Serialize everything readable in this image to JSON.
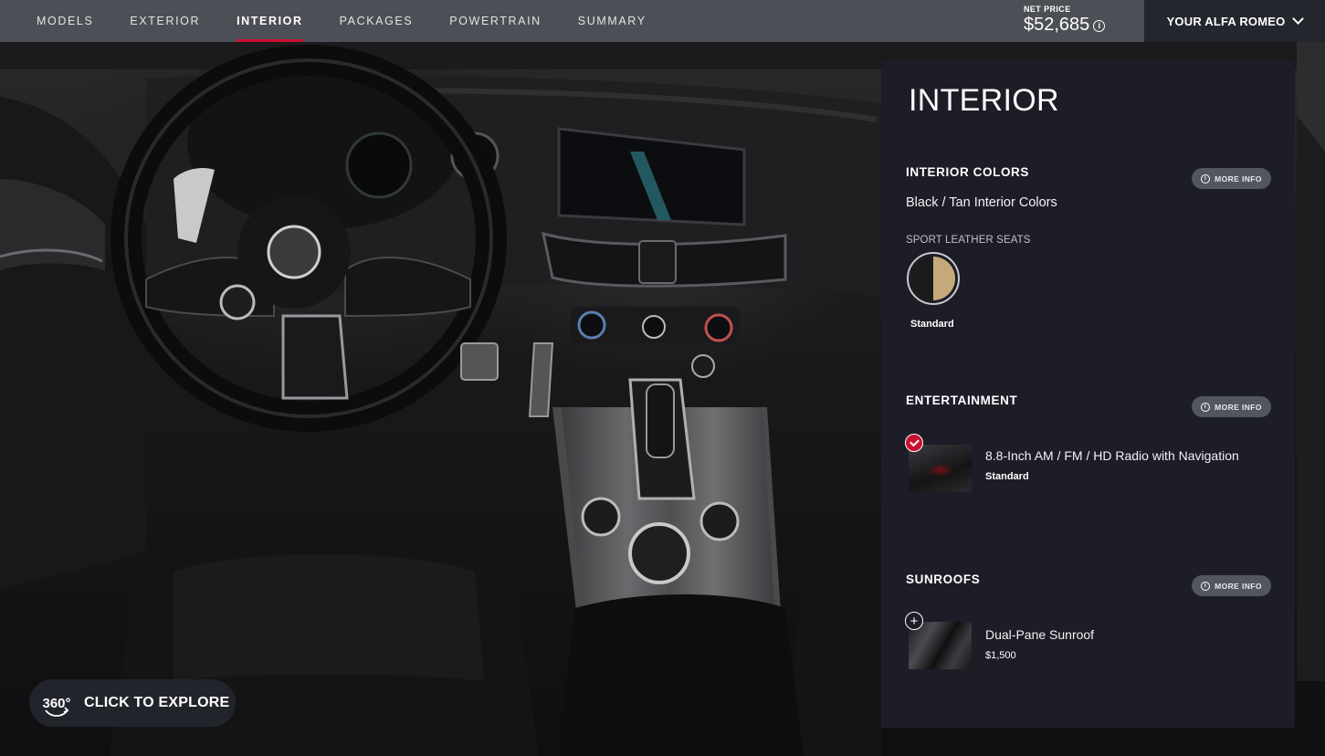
{
  "nav": {
    "items": [
      {
        "label": "MODELS",
        "active": false
      },
      {
        "label": "EXTERIOR",
        "active": false
      },
      {
        "label": "INTERIOR",
        "active": true
      },
      {
        "label": "PACKAGES",
        "active": false
      },
      {
        "label": "POWERTRAIN",
        "active": false
      },
      {
        "label": "SUMMARY",
        "active": false
      }
    ],
    "accent_color": "#c8102e"
  },
  "price": {
    "label": "NET PRICE",
    "value": "$52,685",
    "info_icon": "info-circle-icon"
  },
  "account": {
    "label": "YOUR ALFA ROMEO",
    "icon": "chevron-down-icon"
  },
  "explore": {
    "icon_text": "360°",
    "label": "CLICK TO EXPLORE"
  },
  "panel": {
    "title": "INTERIOR",
    "more_info_label": "MORE INFO",
    "interior_colors": {
      "title": "INTERIOR COLORS",
      "selected": "Black / Tan Interior Colors",
      "seat_label": "SPORT LEATHER SEATS",
      "swatch_caption": "Standard",
      "swatch_colors": [
        "#1b1b1c",
        "#c4a97a"
      ]
    },
    "entertainment": {
      "title": "ENTERTAINMENT",
      "item_name": "8.8-Inch AM / FM / HD Radio with Navigation",
      "item_sub": "Standard",
      "selected": true
    },
    "sunroofs": {
      "title": "SUNROOFS",
      "item_name": "Dual-Pane Sunroof",
      "item_price": "$1,500",
      "selected": false
    }
  }
}
